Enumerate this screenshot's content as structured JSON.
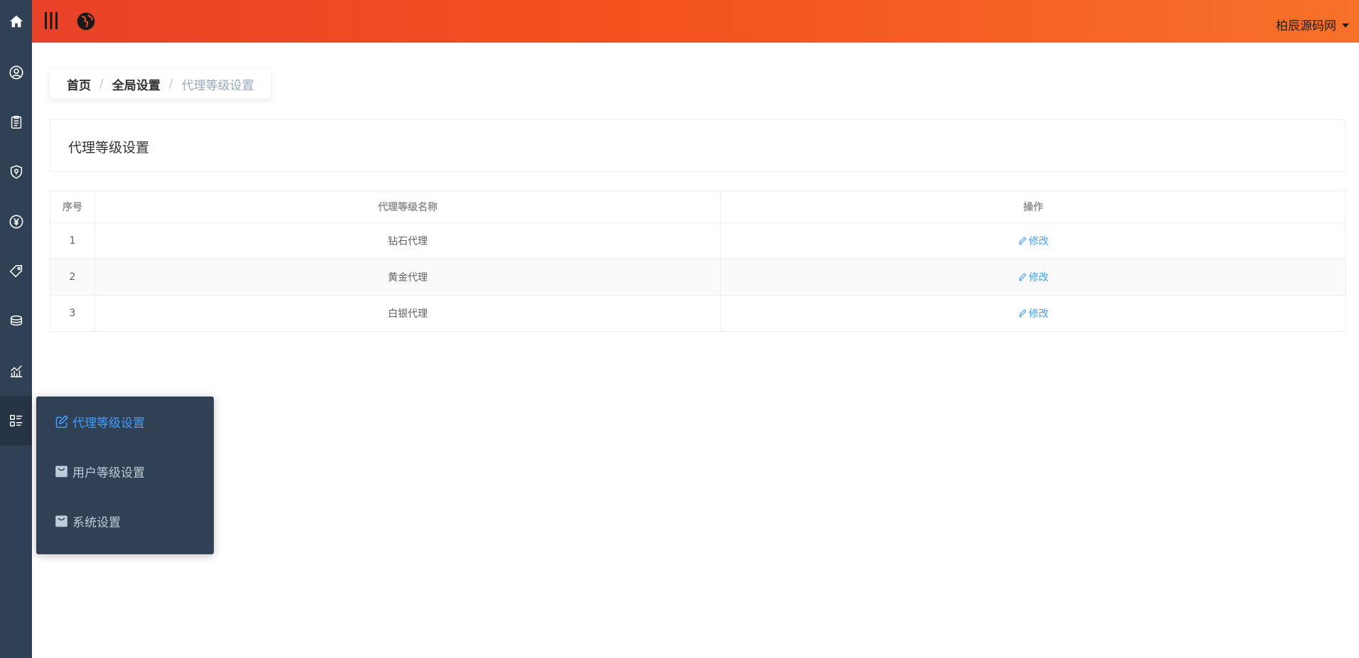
{
  "header": {
    "user_name": "柏辰源码网"
  },
  "rail": {
    "icons": [
      "home-icon",
      "user-circle-icon",
      "clipboard-icon",
      "shield-icon",
      "yen-icon",
      "tag-icon",
      "coins-icon",
      "chart-icon",
      "list-icon"
    ],
    "active_index": 8
  },
  "breadcrumb": {
    "home": "首页",
    "parent": "全局设置",
    "current": "代理等级设置",
    "separator": "/"
  },
  "page": {
    "title": "代理等级设置"
  },
  "table": {
    "headers": [
      "序号",
      "代理等级名称",
      "操作"
    ],
    "rows": [
      {
        "index": "1",
        "name": "钻石代理",
        "action": "修改"
      },
      {
        "index": "2",
        "name": "黄金代理",
        "action": "修改"
      },
      {
        "index": "3",
        "name": "白银代理",
        "action": "修改"
      }
    ]
  },
  "submenu": {
    "items": [
      {
        "label": "代理等级设置",
        "icon": "edit-icon",
        "active": true
      },
      {
        "label": "用户等级设置",
        "icon": "bag-icon",
        "active": false
      },
      {
        "label": "系统设置",
        "icon": "bag-icon",
        "active": false
      }
    ]
  },
  "colors": {
    "rail_bg": "#304156",
    "header_gradient_start": "#e84228",
    "header_gradient_end": "#f7712a",
    "accent": "#409eff"
  }
}
